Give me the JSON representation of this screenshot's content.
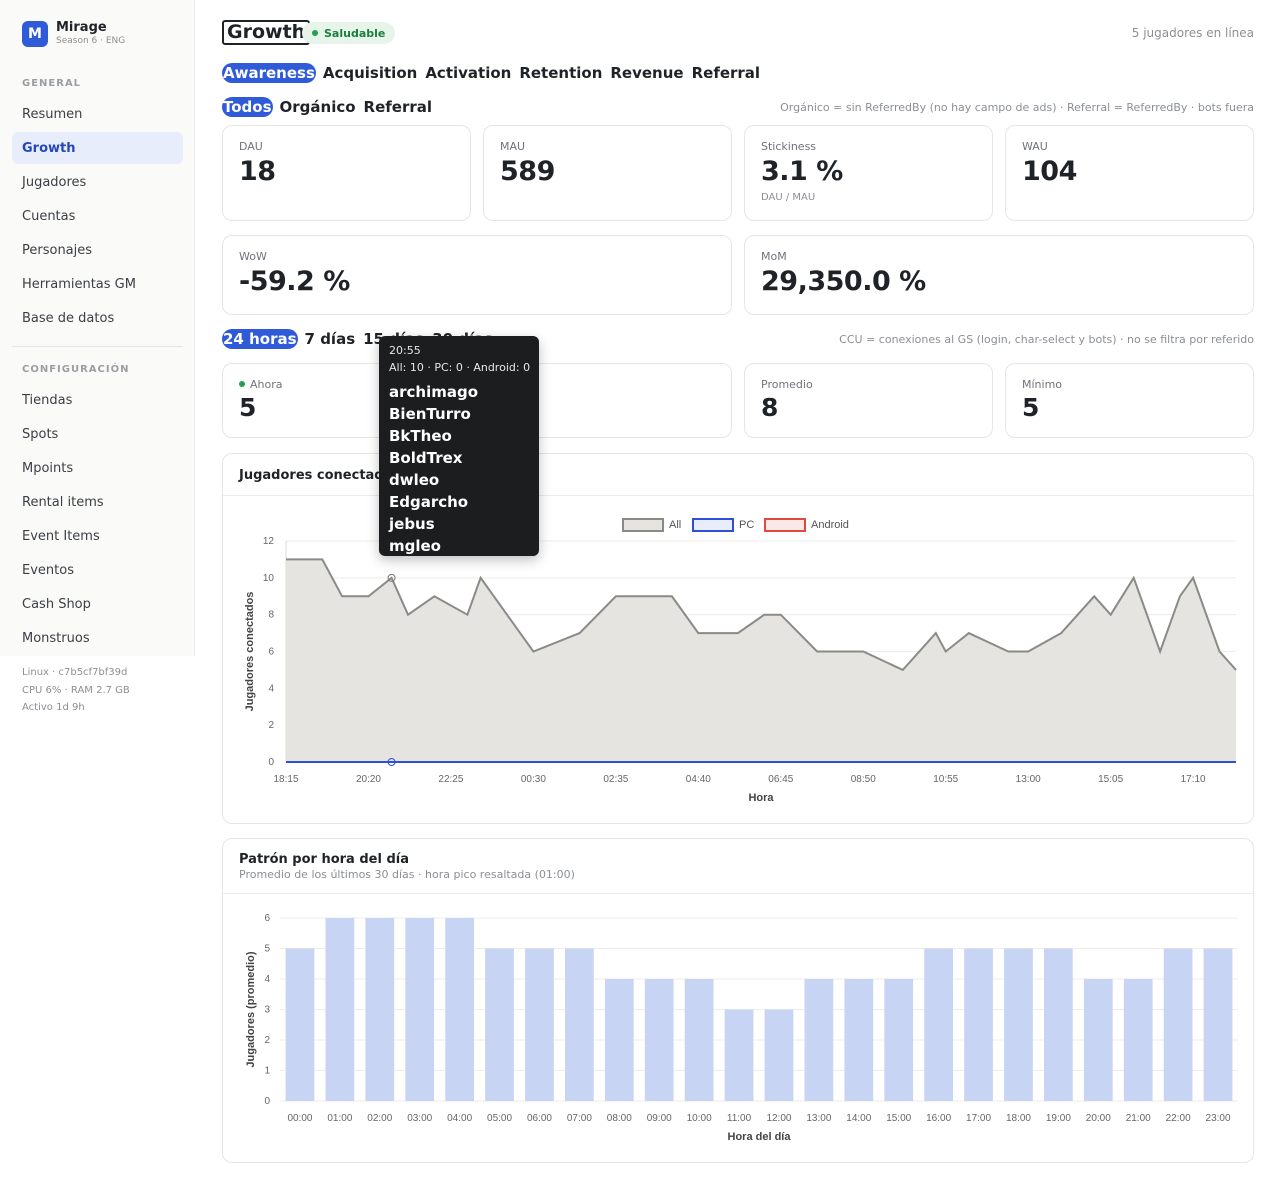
{
  "sidebar": {
    "brand": {
      "logo": "M",
      "name": "Mirage",
      "sub": "Season 6 · ENG"
    },
    "sections": [
      {
        "title": "GENERAL",
        "items": [
          "Resumen",
          "Growth",
          "Jugadores",
          "Cuentas",
          "Personajes",
          "Herramientas GM",
          "Base de datos"
        ]
      },
      {
        "title": "CONFIGURACIÓN",
        "items": [
          "Tiendas",
          "Spots",
          "Mpoints",
          "Rental items",
          "Event Items",
          "Eventos",
          "Cash Shop",
          "Monstruos"
        ]
      }
    ],
    "active_item": "Growth",
    "system": {
      "line1": "Linux · c7b5cf7bf39d",
      "line2": "CPU 6% · RAM 2.7 GB",
      "line3": "Activo 1d 9h"
    }
  },
  "header": {
    "title": "Growth",
    "status": "Saludable",
    "online": "5 jugadores en línea"
  },
  "funnel_tabs": {
    "items": [
      "Awareness",
      "Acquisition",
      "Activation",
      "Retention",
      "Revenue",
      "Referral"
    ],
    "active": "Awareness"
  },
  "source_tabs": {
    "items": [
      "Todos",
      "Orgánico",
      "Referral"
    ],
    "active": "Todos",
    "note": "Orgánico = sin ReferredBy (no hay campo de ads) · Referral = ReferredBy · bots fuera"
  },
  "kpis": {
    "dau": {
      "label": "DAU",
      "value": "18"
    },
    "mau": {
      "label": "MAU",
      "value": "589"
    },
    "stickiness": {
      "label": "Stickiness",
      "value": "3.1 %",
      "sub": "DAU / MAU"
    },
    "wau": {
      "label": "WAU",
      "value": "104"
    },
    "wow": {
      "label": "WoW",
      "value": "-59.2 %"
    },
    "mom": {
      "label": "MoM",
      "value": "29,350.0 %"
    }
  },
  "range_tabs": {
    "items": [
      "24 horas",
      "7 días",
      "15 días",
      "30 días"
    ],
    "active": "24 horas",
    "note": "CCU = conexiones al GS (login, char-select y bots) · no se filtra por referido"
  },
  "ccu": {
    "now": {
      "label": "Ahora",
      "value": "5"
    },
    "avg": {
      "label": "Promedio",
      "value": "8"
    },
    "min": {
      "label": "Mínimo",
      "value": "5"
    }
  },
  "tooltip": {
    "time": "20:55",
    "counts": "All: 10 · PC: 0 · Android: 0",
    "names": [
      "archimago",
      "BienTurro",
      "BkTheo",
      "BoldTrex",
      "dwleo",
      "Edgarcho",
      "jebus",
      "mgleo"
    ]
  },
  "chart_data": [
    {
      "type": "area",
      "title": "Jugadores conectados",
      "xlabel": "Hora",
      "ylabel": "Jugadores conectados",
      "ylim": [
        0,
        12
      ],
      "yticks": [
        0,
        2,
        4,
        6,
        8,
        10,
        12
      ],
      "xticks": [
        "18:15",
        "20:20",
        "22:25",
        "00:30",
        "02:35",
        "04:40",
        "06:45",
        "08:50",
        "10:55",
        "13:00",
        "15:05",
        "17:10"
      ],
      "legend": "top-center",
      "grid": true,
      "colors": {
        "All": "#8a8a86",
        "PC": "#2f4fd8",
        "Android": "#e0493d"
      },
      "series": [
        {
          "name": "All",
          "x": [
            "18:15",
            "19:10",
            "19:40",
            "20:20",
            "20:55",
            "21:20",
            "22:00",
            "22:50",
            "23:10",
            "00:30",
            "01:40",
            "02:35",
            "03:10",
            "04:00",
            "04:40",
            "05:40",
            "06:20",
            "06:45",
            "07:40",
            "08:20",
            "08:50",
            "09:50",
            "10:40",
            "10:55",
            "11:30",
            "12:30",
            "13:00",
            "13:50",
            "14:40",
            "15:05",
            "15:40",
            "16:20",
            "16:50",
            "17:10",
            "17:50",
            "18:15"
          ],
          "values": [
            11,
            11,
            9,
            9,
            10,
            8,
            9,
            8,
            10,
            6,
            7,
            9,
            9,
            9,
            7,
            7,
            8,
            8,
            6,
            6,
            6,
            5,
            7,
            6,
            7,
            6,
            6,
            7,
            9,
            8,
            10,
            6,
            9,
            10,
            6,
            5
          ]
        },
        {
          "name": "PC",
          "values": [
            0
          ]
        },
        {
          "name": "Android",
          "values": [
            0
          ]
        }
      ]
    },
    {
      "type": "bar",
      "title": "Patrón por hora del día",
      "subtitle": "Promedio de los últimos 30 días · hora pico resaltada (01:00)",
      "xlabel": "Hora del día",
      "ylabel": "Jugadores (promedio)",
      "ylim": [
        0,
        6
      ],
      "yticks": [
        0,
        1,
        2,
        3,
        4,
        5,
        6
      ],
      "grid": true,
      "bar_color": "#c8d4f3",
      "categories": [
        "00:00",
        "01:00",
        "02:00",
        "03:00",
        "04:00",
        "05:00",
        "06:00",
        "07:00",
        "08:00",
        "09:00",
        "10:00",
        "11:00",
        "12:00",
        "13:00",
        "14:00",
        "15:00",
        "16:00",
        "17:00",
        "18:00",
        "19:00",
        "20:00",
        "21:00",
        "22:00",
        "23:00"
      ],
      "values": [
        5,
        6,
        6,
        6,
        6,
        5,
        5,
        5,
        4,
        4,
        4,
        3,
        3,
        4,
        4,
        4,
        5,
        5,
        5,
        5,
        4,
        4,
        5,
        5
      ]
    }
  ]
}
